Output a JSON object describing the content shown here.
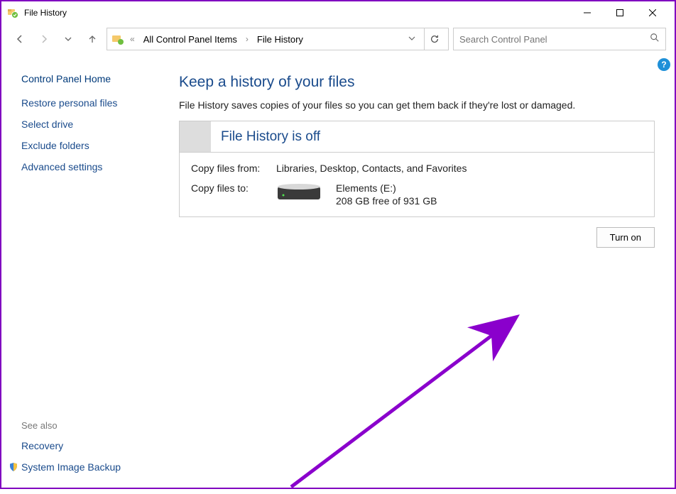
{
  "window": {
    "title": "File History"
  },
  "breadcrumbs": {
    "item1": "All Control Panel Items",
    "item2": "File History"
  },
  "search": {
    "placeholder": "Search Control Panel"
  },
  "sidebar": {
    "home": "Control Panel Home",
    "restore": "Restore personal files",
    "select_drive": "Select drive",
    "exclude": "Exclude folders",
    "advanced": "Advanced settings",
    "see_also": "See also",
    "recovery": "Recovery",
    "sys_backup": "System Image Backup"
  },
  "main": {
    "heading": "Keep a history of your files",
    "subtext": "File History saves copies of your files so you can get them back if they're lost or damaged.",
    "panel_title": "File History is off",
    "copy_from_label": "Copy files from:",
    "copy_from_value": "Libraries, Desktop, Contacts, and Favorites",
    "copy_to_label": "Copy files to:",
    "drive_name": "Elements (E:)",
    "drive_free": "208 GB free of 931 GB",
    "turn_on": "Turn on"
  }
}
